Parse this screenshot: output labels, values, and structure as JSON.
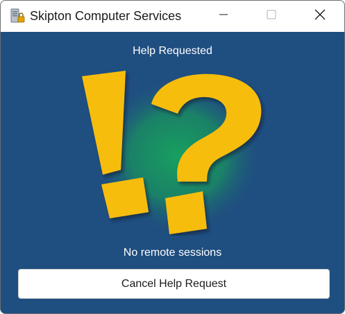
{
  "window": {
    "title": "Skipton Computer Services",
    "icon": "server-lock-icon",
    "controls": {
      "minimize": "minimize-icon",
      "maximize": "maximize-icon",
      "close": "close-icon"
    }
  },
  "main": {
    "status_title": "Help Requested",
    "artwork": "exclamation-question-icon",
    "sessions_text": "No remote sessions",
    "cancel_label": "Cancel Help Request"
  },
  "colors": {
    "background": "#1f4e80",
    "glow": "#1f8a63",
    "symbol_yellow": "#f7bd0a",
    "text": "#ffffff"
  }
}
